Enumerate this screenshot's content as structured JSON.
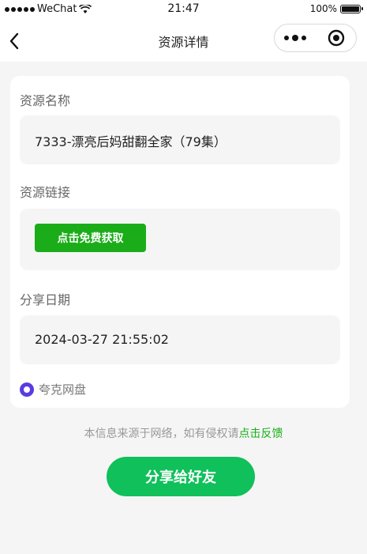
{
  "status_bar": {
    "carrier": "WeChat",
    "time": "21:47",
    "battery": "100%"
  },
  "nav": {
    "title": "资源详情"
  },
  "resource": {
    "name_label": "资源名称",
    "name_value": "7333-漂亮后妈甜翻全家（79集）",
    "link_label": "资源链接",
    "link_button": "点击免费获取",
    "date_label": "分享日期",
    "date_value": "2024-03-27 21:55:02",
    "source": "夸克网盘"
  },
  "footer": {
    "disclaimer_prefix": "本信息来源于网络，如有侵权请",
    "feedback_link": "点击反馈",
    "share_button": "分享给好友"
  },
  "colors": {
    "accent_green": "#1aad19",
    "share_green": "#10c05a",
    "quark_purple": "#5a3ce0"
  }
}
